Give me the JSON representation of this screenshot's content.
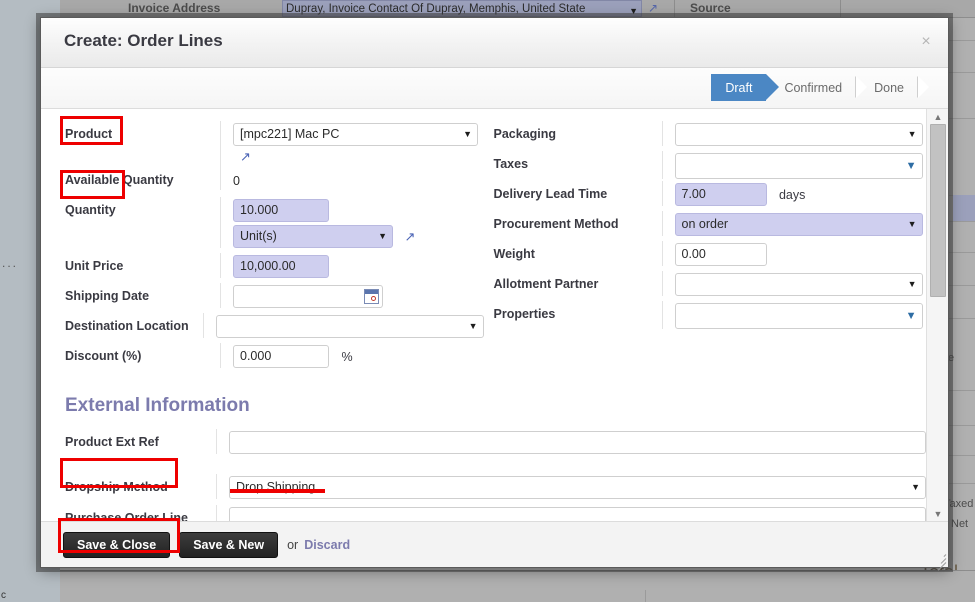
{
  "background": {
    "invoice_address_label": "Invoice Address",
    "invoice_address_value": "Dupray, Invoice Contact Of Dupray, Memphis, United State",
    "source_label": "Source",
    "taxed_label": "Taxed",
    "net_label": "Net",
    "total_label": "Total",
    "ellipsis": "...",
    "partial_e": "e",
    "bottom_left_glyph": "c"
  },
  "modal": {
    "title": "Create: Order Lines",
    "close_label": "×",
    "statusbar": [
      {
        "label": "Draft",
        "active": true
      },
      {
        "label": "Confirmed",
        "active": false
      },
      {
        "label": "Done",
        "active": false
      }
    ],
    "left_fields": {
      "product": {
        "label": "Product",
        "value": "[mpc221] Mac PC",
        "highlight": true
      },
      "available_quantity": {
        "label": "Available Quantity",
        "value": "0"
      },
      "quantity": {
        "label": "Quantity",
        "value": "10.000",
        "uom": "Unit(s)",
        "highlight": true
      },
      "unit_price": {
        "label": "Unit Price",
        "value": "10,000.00"
      },
      "shipping_date": {
        "label": "Shipping Date",
        "value": ""
      },
      "destination_location": {
        "label": "Destination Location",
        "value": ""
      },
      "discount": {
        "label": "Discount (%)",
        "value": "0.000",
        "suffix": "%"
      }
    },
    "right_fields": {
      "packaging": {
        "label": "Packaging",
        "value": ""
      },
      "taxes": {
        "label": "Taxes",
        "value": ""
      },
      "delivery_lead_time": {
        "label": "Delivery Lead Time",
        "value": "7.00",
        "suffix": "days"
      },
      "procurement_method": {
        "label": "Procurement Method",
        "value": "on order"
      },
      "weight": {
        "label": "Weight",
        "value": "0.00"
      },
      "allotment_partner": {
        "label": "Allotment Partner",
        "value": ""
      },
      "properties": {
        "label": "Properties",
        "value": ""
      }
    },
    "external_section": {
      "heading": "External Information",
      "product_ext_ref": {
        "label": "Product Ext Ref",
        "value": ""
      },
      "dropship_method": {
        "label": "Dropship Method",
        "value": "Drop Shipping",
        "highlight": true
      },
      "purchase_order_line": {
        "label": "Purchase Order Line",
        "value": ""
      }
    },
    "footer": {
      "save_close_label": "Save & Close",
      "save_new_label": "Save & New",
      "or_label": "or",
      "discard_label": "Discard"
    }
  },
  "colors": {
    "highlight": "#ee0000",
    "required_field": "#cfcfef",
    "active_status": "#4b87c4",
    "section_heading": "#7c7bad",
    "link": "#7c7bad"
  }
}
